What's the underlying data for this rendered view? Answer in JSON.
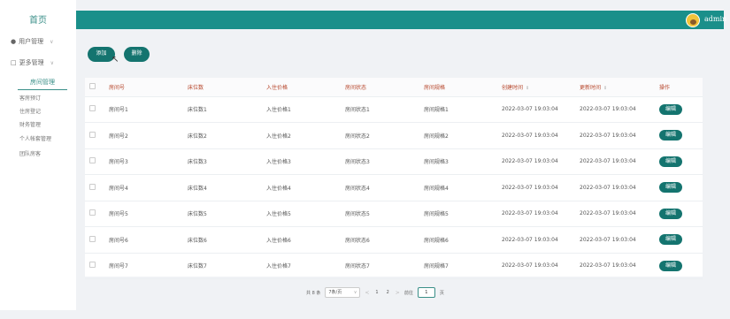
{
  "sidebar": {
    "home": "首页",
    "menus": [
      {
        "label": "用户管理",
        "icon": "user-icon"
      },
      {
        "label": "更多管理",
        "icon": "square-icon"
      }
    ],
    "active": "房间管理",
    "subs": [
      "客房预订",
      "住房登记",
      "财务管理",
      "个人帐套管理",
      "团队房客"
    ]
  },
  "topbar": {
    "username": "admin"
  },
  "toolbar": {
    "add_label": "添加",
    "delete_label": "删除"
  },
  "table": {
    "headers": [
      "房间号",
      "床位数",
      "入住价格",
      "房间状态",
      "房间规格",
      "创建时间",
      "更新时间",
      "操作"
    ],
    "edit_label": "编辑",
    "rows": [
      [
        "房间号1",
        "床位数1",
        "入住价格1",
        "房间状态1",
        "房间规格1",
        "2022-03-07 19:03:04",
        "2022-03-07 19:03:04"
      ],
      [
        "房间号2",
        "床位数2",
        "入住价格2",
        "房间状态2",
        "房间规格2",
        "2022-03-07 19:03:04",
        "2022-03-07 19:03:04"
      ],
      [
        "房间号3",
        "床位数3",
        "入住价格3",
        "房间状态3",
        "房间规格3",
        "2022-03-07 19:03:04",
        "2022-03-07 19:03:04"
      ],
      [
        "房间号4",
        "床位数4",
        "入住价格4",
        "房间状态4",
        "房间规格4",
        "2022-03-07 19:03:04",
        "2022-03-07 19:03:04"
      ],
      [
        "房间号5",
        "床位数5",
        "入住价格5",
        "房间状态5",
        "房间规格5",
        "2022-03-07 19:03:04",
        "2022-03-07 19:03:04"
      ],
      [
        "房间号6",
        "床位数6",
        "入住价格6",
        "房间状态6",
        "房间规格6",
        "2022-03-07 19:03:04",
        "2022-03-07 19:03:04"
      ],
      [
        "房间号7",
        "床位数7",
        "入住价格7",
        "房间状态7",
        "房间规格7",
        "2022-03-07 19:03:04",
        "2022-03-07 19:03:04"
      ]
    ]
  },
  "pagination": {
    "total": "共 8 条",
    "page_size": "7条/页",
    "pages": [
      "1",
      "2"
    ],
    "goto_prefix": "前往",
    "goto_value": "1",
    "goto_suffix": "页"
  },
  "colors": {
    "accent": "#1a8f8a",
    "button": "#14746f",
    "header_text": "#b6452a"
  }
}
